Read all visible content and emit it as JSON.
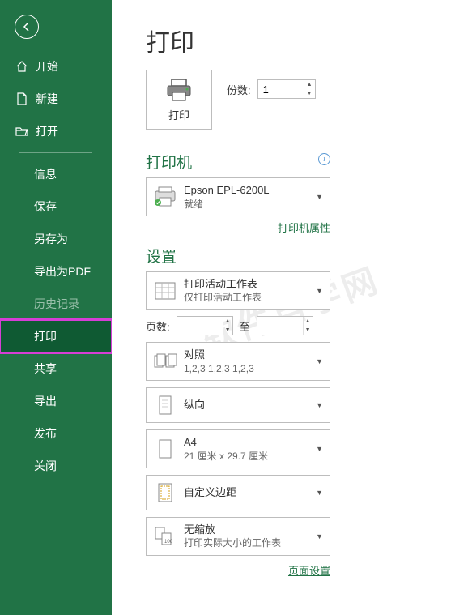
{
  "sidebar": {
    "home": "开始",
    "new": "新建",
    "open": "打开",
    "info": "信息",
    "save": "保存",
    "saveas": "另存为",
    "exportpdf": "导出为PDF",
    "history": "历史记录",
    "print": "打印",
    "share": "共享",
    "export": "导出",
    "publish": "发布",
    "close": "关闭"
  },
  "page": {
    "title": "打印",
    "print_btn": "打印",
    "copies_label": "份数:",
    "copies_value": "1"
  },
  "printer": {
    "section": "打印机",
    "name": "Epson EPL-6200L",
    "status": "就绪",
    "props_link": "打印机属性"
  },
  "settings": {
    "section": "设置",
    "what": {
      "title": "打印活动工作表",
      "sub": "仅打印活动工作表"
    },
    "pages_label": "页数:",
    "pages_to": "至",
    "pages_from": "",
    "pages_to_val": "",
    "collate": {
      "title": "对照",
      "sub": "1,2,3    1,2,3    1,2,3"
    },
    "orient": {
      "title": "纵向"
    },
    "paper": {
      "title": "A4",
      "sub": "21 厘米 x 29.7 厘米"
    },
    "margins": {
      "title": "自定义边距"
    },
    "scale": {
      "title": "无缩放",
      "sub": "打印实际大小的工作表"
    },
    "page_setup_link": "页面设置"
  },
  "watermark": "软件自学网"
}
